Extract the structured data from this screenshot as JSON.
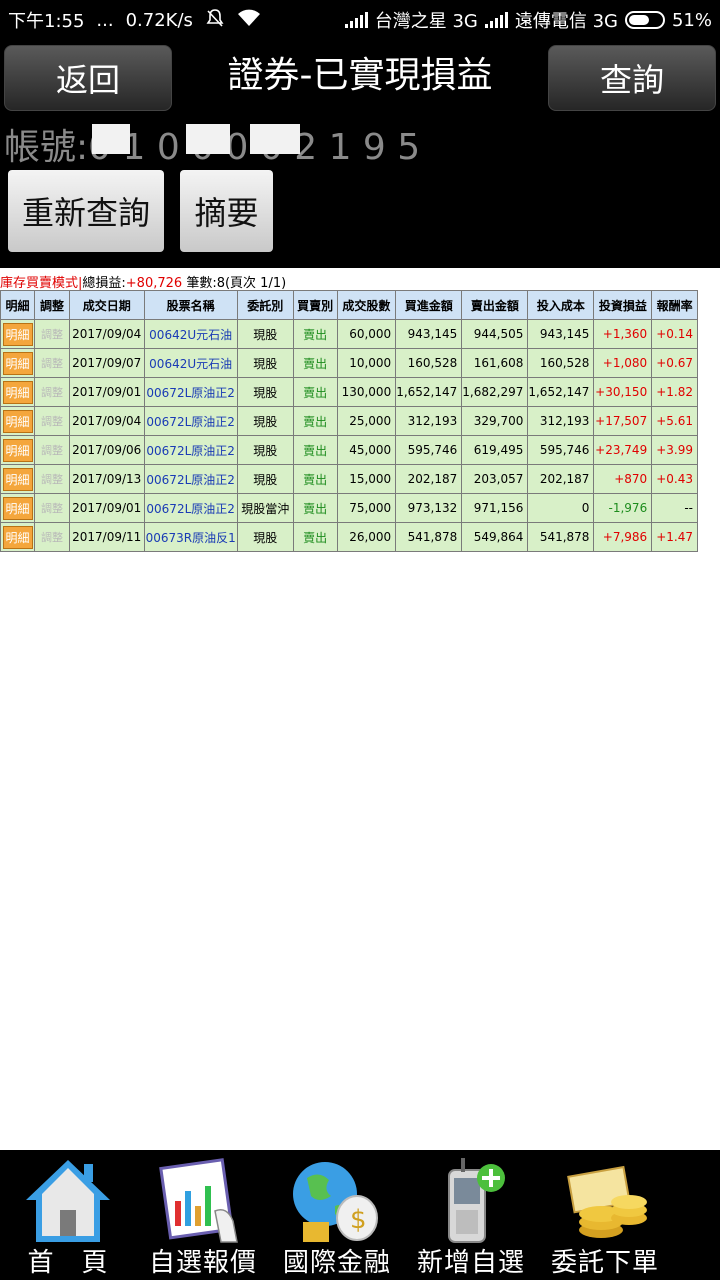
{
  "status_bar": {
    "time": "下午1:55",
    "dots": "...",
    "net_speed": "0.72K/s",
    "carrier1": "台灣之星 3G",
    "carrier2": "遠傳電信 3G",
    "battery": "51%"
  },
  "header": {
    "back_label": "返回",
    "title": "證券-已實現損益",
    "query_label": "查詢",
    "account_text": "帳號:0 1 0 0 0 0 2 1 9 5",
    "requery_label": "重新查詢",
    "summary_label": "摘要"
  },
  "summary": {
    "mode": "庫存買賣模式|",
    "total_label": "總損益:",
    "total_value": "+80,726",
    "count_text": "筆數:8(頁次 1/1)"
  },
  "table": {
    "headers": [
      "明細",
      "調整",
      "成交日期",
      "股票名稱",
      "委託別",
      "買賣別",
      "成交股數",
      "買進金額",
      "賣出金額",
      "投入成本",
      "投資損益",
      "報酬率"
    ],
    "rows": [
      {
        "detail": "明細",
        "adjust": "調整",
        "date": "2017/09/04",
        "stock": "00642U元石油",
        "order_type": "現股",
        "side": "賣出",
        "shares": "60,000",
        "buy_amount": "943,145",
        "sell_amount": "944,505",
        "cost": "943,145",
        "pnl": "+1,360",
        "roi": "+0.14"
      },
      {
        "detail": "明細",
        "adjust": "調整",
        "date": "2017/09/07",
        "stock": "00642U元石油",
        "order_type": "現股",
        "side": "賣出",
        "shares": "10,000",
        "buy_amount": "160,528",
        "sell_amount": "161,608",
        "cost": "160,528",
        "pnl": "+1,080",
        "roi": "+0.67"
      },
      {
        "detail": "明細",
        "adjust": "調整",
        "date": "2017/09/01",
        "stock": "00672L原油正2",
        "order_type": "現股",
        "side": "賣出",
        "shares": "130,000",
        "buy_amount": "1,652,147",
        "sell_amount": "1,682,297",
        "cost": "1,652,147",
        "pnl": "+30,150",
        "roi": "+1.82"
      },
      {
        "detail": "明細",
        "adjust": "調整",
        "date": "2017/09/04",
        "stock": "00672L原油正2",
        "order_type": "現股",
        "side": "賣出",
        "shares": "25,000",
        "buy_amount": "312,193",
        "sell_amount": "329,700",
        "cost": "312,193",
        "pnl": "+17,507",
        "roi": "+5.61"
      },
      {
        "detail": "明細",
        "adjust": "調整",
        "date": "2017/09/06",
        "stock": "00672L原油正2",
        "order_type": "現股",
        "side": "賣出",
        "shares": "45,000",
        "buy_amount": "595,746",
        "sell_amount": "619,495",
        "cost": "595,746",
        "pnl": "+23,749",
        "roi": "+3.99"
      },
      {
        "detail": "明細",
        "adjust": "調整",
        "date": "2017/09/13",
        "stock": "00672L原油正2",
        "order_type": "現股",
        "side": "賣出",
        "shares": "15,000",
        "buy_amount": "202,187",
        "sell_amount": "203,057",
        "cost": "202,187",
        "pnl": "+870",
        "roi": "+0.43"
      },
      {
        "detail": "明細",
        "adjust": "調整",
        "date": "2017/09/01",
        "stock": "00672L原油正2",
        "order_type": "現股當沖",
        "side": "賣出",
        "shares": "75,000",
        "buy_amount": "973,132",
        "sell_amount": "971,156",
        "cost": "0",
        "pnl": "-1,976",
        "roi": "--"
      },
      {
        "detail": "明細",
        "adjust": "調整",
        "date": "2017/09/11",
        "stock": "00673R原油反1",
        "order_type": "現股",
        "side": "賣出",
        "shares": "26,000",
        "buy_amount": "541,878",
        "sell_amount": "549,864",
        "cost": "541,878",
        "pnl": "+7,986",
        "roi": "+1.47"
      }
    ]
  },
  "bottom_nav": [
    {
      "label": "首　頁",
      "icon": "home-icon"
    },
    {
      "label": "自選報價",
      "icon": "quote-chart-icon"
    },
    {
      "label": "國際金融",
      "icon": "globe-money-icon"
    },
    {
      "label": "新增自選",
      "icon": "phone-add-icon"
    },
    {
      "label": "委託下單",
      "icon": "coins-order-icon"
    }
  ],
  "colors": {
    "header_bg": "#000000",
    "table_header": "#cfe2f5",
    "row_bg": "#d8f0c8",
    "positive": "#e00000",
    "negative": "#1d8c1d",
    "stock_link": "#1a3bb5"
  }
}
